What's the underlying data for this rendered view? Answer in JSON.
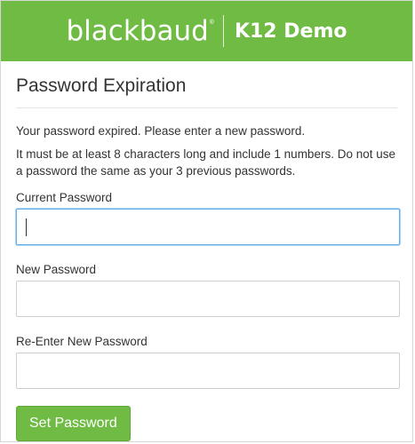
{
  "header": {
    "brand_name": "blackbaud",
    "brand_tm": "®",
    "product_name": "K12 Demo",
    "background_color": "#6fbb44"
  },
  "main": {
    "title": "Password Expiration",
    "message_expired": "Your password expired. Please enter a new password.",
    "message_rules": "It must be at least 8 characters long and include 1 numbers. Do not use a password the same as your 3 previous passwords.",
    "fields": {
      "current_password_label": "Current Password",
      "current_password_value": "",
      "new_password_label": "New Password",
      "new_password_value": "",
      "reenter_password_label": "Re-Enter New Password",
      "reenter_password_value": ""
    },
    "submit_label": "Set Password",
    "accent_color": "#6fbb44",
    "focus_color": "#66afe9"
  }
}
